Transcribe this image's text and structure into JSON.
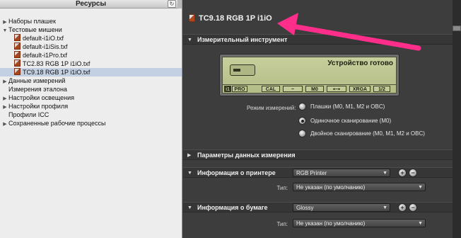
{
  "left_panel": {
    "title": "Ресурсы",
    "refresh_icon": "↻",
    "tree": [
      {
        "label": "Наборы плашек",
        "arrow": "▶",
        "kind": "group"
      },
      {
        "label": "Тестовые мишени",
        "arrow": "▼",
        "kind": "group"
      },
      {
        "label": "default-i1iO.txf",
        "kind": "file"
      },
      {
        "label": "default-i1iSis.txf",
        "kind": "file"
      },
      {
        "label": "default-i1Pro.txf",
        "kind": "file"
      },
      {
        "label": "TC2.83 RGB 1P i1iO.txf",
        "kind": "file"
      },
      {
        "label": "TC9.18 RGB 1P i1iO.txf",
        "kind": "file",
        "selected": true
      },
      {
        "label": "Данные измерений",
        "arrow": "▶",
        "kind": "group"
      },
      {
        "label": "Измерения эталона",
        "kind": "group"
      },
      {
        "label": "Настройки освещения",
        "arrow": "▶",
        "kind": "group"
      },
      {
        "label": "Настройки профиля",
        "arrow": "▶",
        "kind": "group"
      },
      {
        "label": "Профили ICC",
        "kind": "group"
      },
      {
        "label": "Сохраненные рабочие процессы",
        "arrow": "▶",
        "kind": "group"
      }
    ]
  },
  "document": {
    "title": "TC9.18 RGB 1P i1iO",
    "icon": "txf-file-icon"
  },
  "instrument": {
    "section_label": "Измерительный инструмент",
    "lcd_status": "Устройство готово",
    "lcd_segments": [
      "i1",
      "PRO",
      "CAL",
      "~",
      "M0",
      "⟷",
      "XRGA",
      "1/2"
    ],
    "mode_label": "Режим измерений:",
    "modes": [
      {
        "label": "Плашки (M0, M1, M2 и OBC)",
        "checked": false
      },
      {
        "label": "Одиночное сканирование (M0)",
        "checked": true
      },
      {
        "label": "Двойное сканирование (M0, M1, M2 и OBC)",
        "checked": false
      }
    ]
  },
  "measurement_params": {
    "section_label": "Параметры данных измерения"
  },
  "printer_info": {
    "section_label": "Информация о принтере",
    "select_value": "RGB Printer",
    "type_label": "Тип:",
    "type_value": "Не указан (по умолчанию)",
    "add_icon": "+",
    "remove_icon": "−"
  },
  "paper_info": {
    "section_label": "Информация о бумаге",
    "select_value": "Glossy",
    "type_label": "Тип:",
    "type_value": "Не указан (по умолчанию)",
    "add_icon": "+",
    "remove_icon": "−"
  },
  "colors": {
    "annotation_arrow": "#ff2e8a",
    "lcd_background": "#c7cf9d",
    "selected_row": "#c3d0e3"
  }
}
